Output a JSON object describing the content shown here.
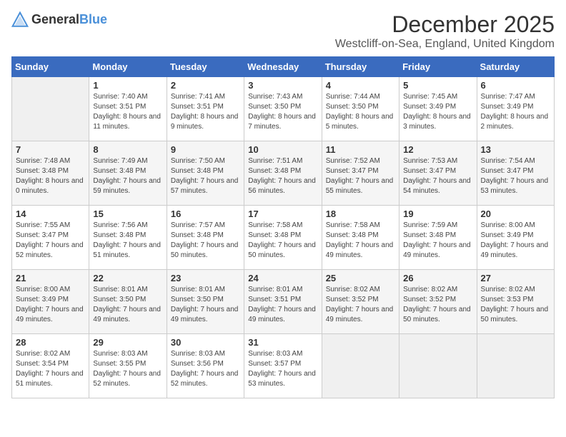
{
  "header": {
    "logo_general": "General",
    "logo_blue": "Blue",
    "title": "December 2025",
    "subtitle": "Westcliff-on-Sea, England, United Kingdom"
  },
  "days_of_week": [
    "Sunday",
    "Monday",
    "Tuesday",
    "Wednesday",
    "Thursday",
    "Friday",
    "Saturday"
  ],
  "weeks": [
    [
      {
        "day": "",
        "sunrise": "",
        "sunset": "",
        "daylight": "",
        "empty": true
      },
      {
        "day": "1",
        "sunrise": "7:40 AM",
        "sunset": "3:51 PM",
        "daylight": "8 hours and 11 minutes."
      },
      {
        "day": "2",
        "sunrise": "7:41 AM",
        "sunset": "3:51 PM",
        "daylight": "8 hours and 9 minutes."
      },
      {
        "day": "3",
        "sunrise": "7:43 AM",
        "sunset": "3:50 PM",
        "daylight": "8 hours and 7 minutes."
      },
      {
        "day": "4",
        "sunrise": "7:44 AM",
        "sunset": "3:50 PM",
        "daylight": "8 hours and 5 minutes."
      },
      {
        "day": "5",
        "sunrise": "7:45 AM",
        "sunset": "3:49 PM",
        "daylight": "8 hours and 3 minutes."
      },
      {
        "day": "6",
        "sunrise": "7:47 AM",
        "sunset": "3:49 PM",
        "daylight": "8 hours and 2 minutes."
      }
    ],
    [
      {
        "day": "7",
        "sunrise": "7:48 AM",
        "sunset": "3:48 PM",
        "daylight": "8 hours and 0 minutes."
      },
      {
        "day": "8",
        "sunrise": "7:49 AM",
        "sunset": "3:48 PM",
        "daylight": "7 hours and 59 minutes."
      },
      {
        "day": "9",
        "sunrise": "7:50 AM",
        "sunset": "3:48 PM",
        "daylight": "7 hours and 57 minutes."
      },
      {
        "day": "10",
        "sunrise": "7:51 AM",
        "sunset": "3:48 PM",
        "daylight": "7 hours and 56 minutes."
      },
      {
        "day": "11",
        "sunrise": "7:52 AM",
        "sunset": "3:47 PM",
        "daylight": "7 hours and 55 minutes."
      },
      {
        "day": "12",
        "sunrise": "7:53 AM",
        "sunset": "3:47 PM",
        "daylight": "7 hours and 54 minutes."
      },
      {
        "day": "13",
        "sunrise": "7:54 AM",
        "sunset": "3:47 PM",
        "daylight": "7 hours and 53 minutes."
      }
    ],
    [
      {
        "day": "14",
        "sunrise": "7:55 AM",
        "sunset": "3:47 PM",
        "daylight": "7 hours and 52 minutes."
      },
      {
        "day": "15",
        "sunrise": "7:56 AM",
        "sunset": "3:48 PM",
        "daylight": "7 hours and 51 minutes."
      },
      {
        "day": "16",
        "sunrise": "7:57 AM",
        "sunset": "3:48 PM",
        "daylight": "7 hours and 50 minutes."
      },
      {
        "day": "17",
        "sunrise": "7:58 AM",
        "sunset": "3:48 PM",
        "daylight": "7 hours and 50 minutes."
      },
      {
        "day": "18",
        "sunrise": "7:58 AM",
        "sunset": "3:48 PM",
        "daylight": "7 hours and 49 minutes."
      },
      {
        "day": "19",
        "sunrise": "7:59 AM",
        "sunset": "3:48 PM",
        "daylight": "7 hours and 49 minutes."
      },
      {
        "day": "20",
        "sunrise": "8:00 AM",
        "sunset": "3:49 PM",
        "daylight": "7 hours and 49 minutes."
      }
    ],
    [
      {
        "day": "21",
        "sunrise": "8:00 AM",
        "sunset": "3:49 PM",
        "daylight": "7 hours and 49 minutes."
      },
      {
        "day": "22",
        "sunrise": "8:01 AM",
        "sunset": "3:50 PM",
        "daylight": "7 hours and 49 minutes."
      },
      {
        "day": "23",
        "sunrise": "8:01 AM",
        "sunset": "3:50 PM",
        "daylight": "7 hours and 49 minutes."
      },
      {
        "day": "24",
        "sunrise": "8:01 AM",
        "sunset": "3:51 PM",
        "daylight": "7 hours and 49 minutes."
      },
      {
        "day": "25",
        "sunrise": "8:02 AM",
        "sunset": "3:52 PM",
        "daylight": "7 hours and 49 minutes."
      },
      {
        "day": "26",
        "sunrise": "8:02 AM",
        "sunset": "3:52 PM",
        "daylight": "7 hours and 50 minutes."
      },
      {
        "day": "27",
        "sunrise": "8:02 AM",
        "sunset": "3:53 PM",
        "daylight": "7 hours and 50 minutes."
      }
    ],
    [
      {
        "day": "28",
        "sunrise": "8:02 AM",
        "sunset": "3:54 PM",
        "daylight": "7 hours and 51 minutes."
      },
      {
        "day": "29",
        "sunrise": "8:03 AM",
        "sunset": "3:55 PM",
        "daylight": "7 hours and 52 minutes."
      },
      {
        "day": "30",
        "sunrise": "8:03 AM",
        "sunset": "3:56 PM",
        "daylight": "7 hours and 52 minutes."
      },
      {
        "day": "31",
        "sunrise": "8:03 AM",
        "sunset": "3:57 PM",
        "daylight": "7 hours and 53 minutes."
      },
      {
        "day": "",
        "sunrise": "",
        "sunset": "",
        "daylight": "",
        "empty": true
      },
      {
        "day": "",
        "sunrise": "",
        "sunset": "",
        "daylight": "",
        "empty": true
      },
      {
        "day": "",
        "sunrise": "",
        "sunset": "",
        "daylight": "",
        "empty": true
      }
    ]
  ],
  "labels": {
    "sunrise_prefix": "Sunrise: ",
    "sunset_prefix": "Sunset: ",
    "daylight_prefix": "Daylight: "
  }
}
